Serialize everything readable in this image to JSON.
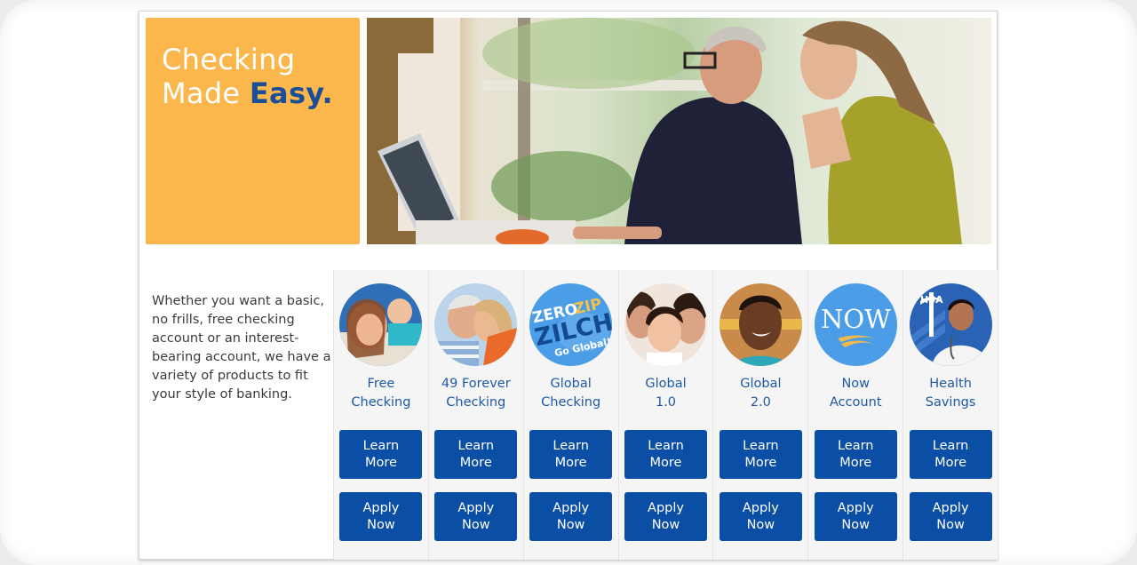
{
  "hero": {
    "title_line1": "Checking",
    "title_line2_plain": "Made ",
    "title_line2_accent": "Easy.",
    "photo_alt": "Older man and young woman looking at a laptop",
    "box_color": "#fbb64c",
    "accent_color": "#1a4f97"
  },
  "intro": {
    "text": "Whether you want a basic, no frills, free checking account or an interest-bearing account, we have a variety of products to fit your style of banking."
  },
  "products": [
    {
      "name_line1": "Free",
      "name_line2": "Checking",
      "image": "mother-and-child-photo",
      "learn": "Learn\nMore",
      "apply": "Apply\nNow"
    },
    {
      "name_line1": "49 Forever",
      "name_line2": "Checking",
      "image": "senior-couple-photo",
      "learn": "Learn\nMore",
      "apply": "Apply\nNow"
    },
    {
      "name_line1": "Global",
      "name_line2": "Checking",
      "image": "zero-zip-zilch-badge",
      "badge_text": [
        "ZERO",
        "ZIP",
        "ZILCH",
        "Go Global!"
      ],
      "learn": "Learn\nMore",
      "apply": "Apply\nNow"
    },
    {
      "name_line1": "Global",
      "name_line2": "1.0",
      "image": "family-women-photo",
      "learn": "Learn\nMore",
      "apply": "Apply\nNow"
    },
    {
      "name_line1": "Global",
      "name_line2": "2.0",
      "image": "smiling-young-man-photo",
      "learn": "Learn\nMore",
      "apply": "Apply\nNow"
    },
    {
      "name_line1": "Now",
      "name_line2": "Account",
      "image": "now-badge",
      "badge_text": [
        "NOW"
      ],
      "learn": "Learn\nMore",
      "apply": "Apply\nNow"
    },
    {
      "name_line1": "Health",
      "name_line2": "Savings",
      "image": "hsa-doctor-photo",
      "badge_text": [
        "HSA"
      ],
      "learn": "Learn\nMore",
      "apply": "Apply\nNow"
    }
  ],
  "colors": {
    "button_bg": "#0a4ea6",
    "product_name": "#1d5aa5",
    "badge_blue": "#4a9de6"
  }
}
